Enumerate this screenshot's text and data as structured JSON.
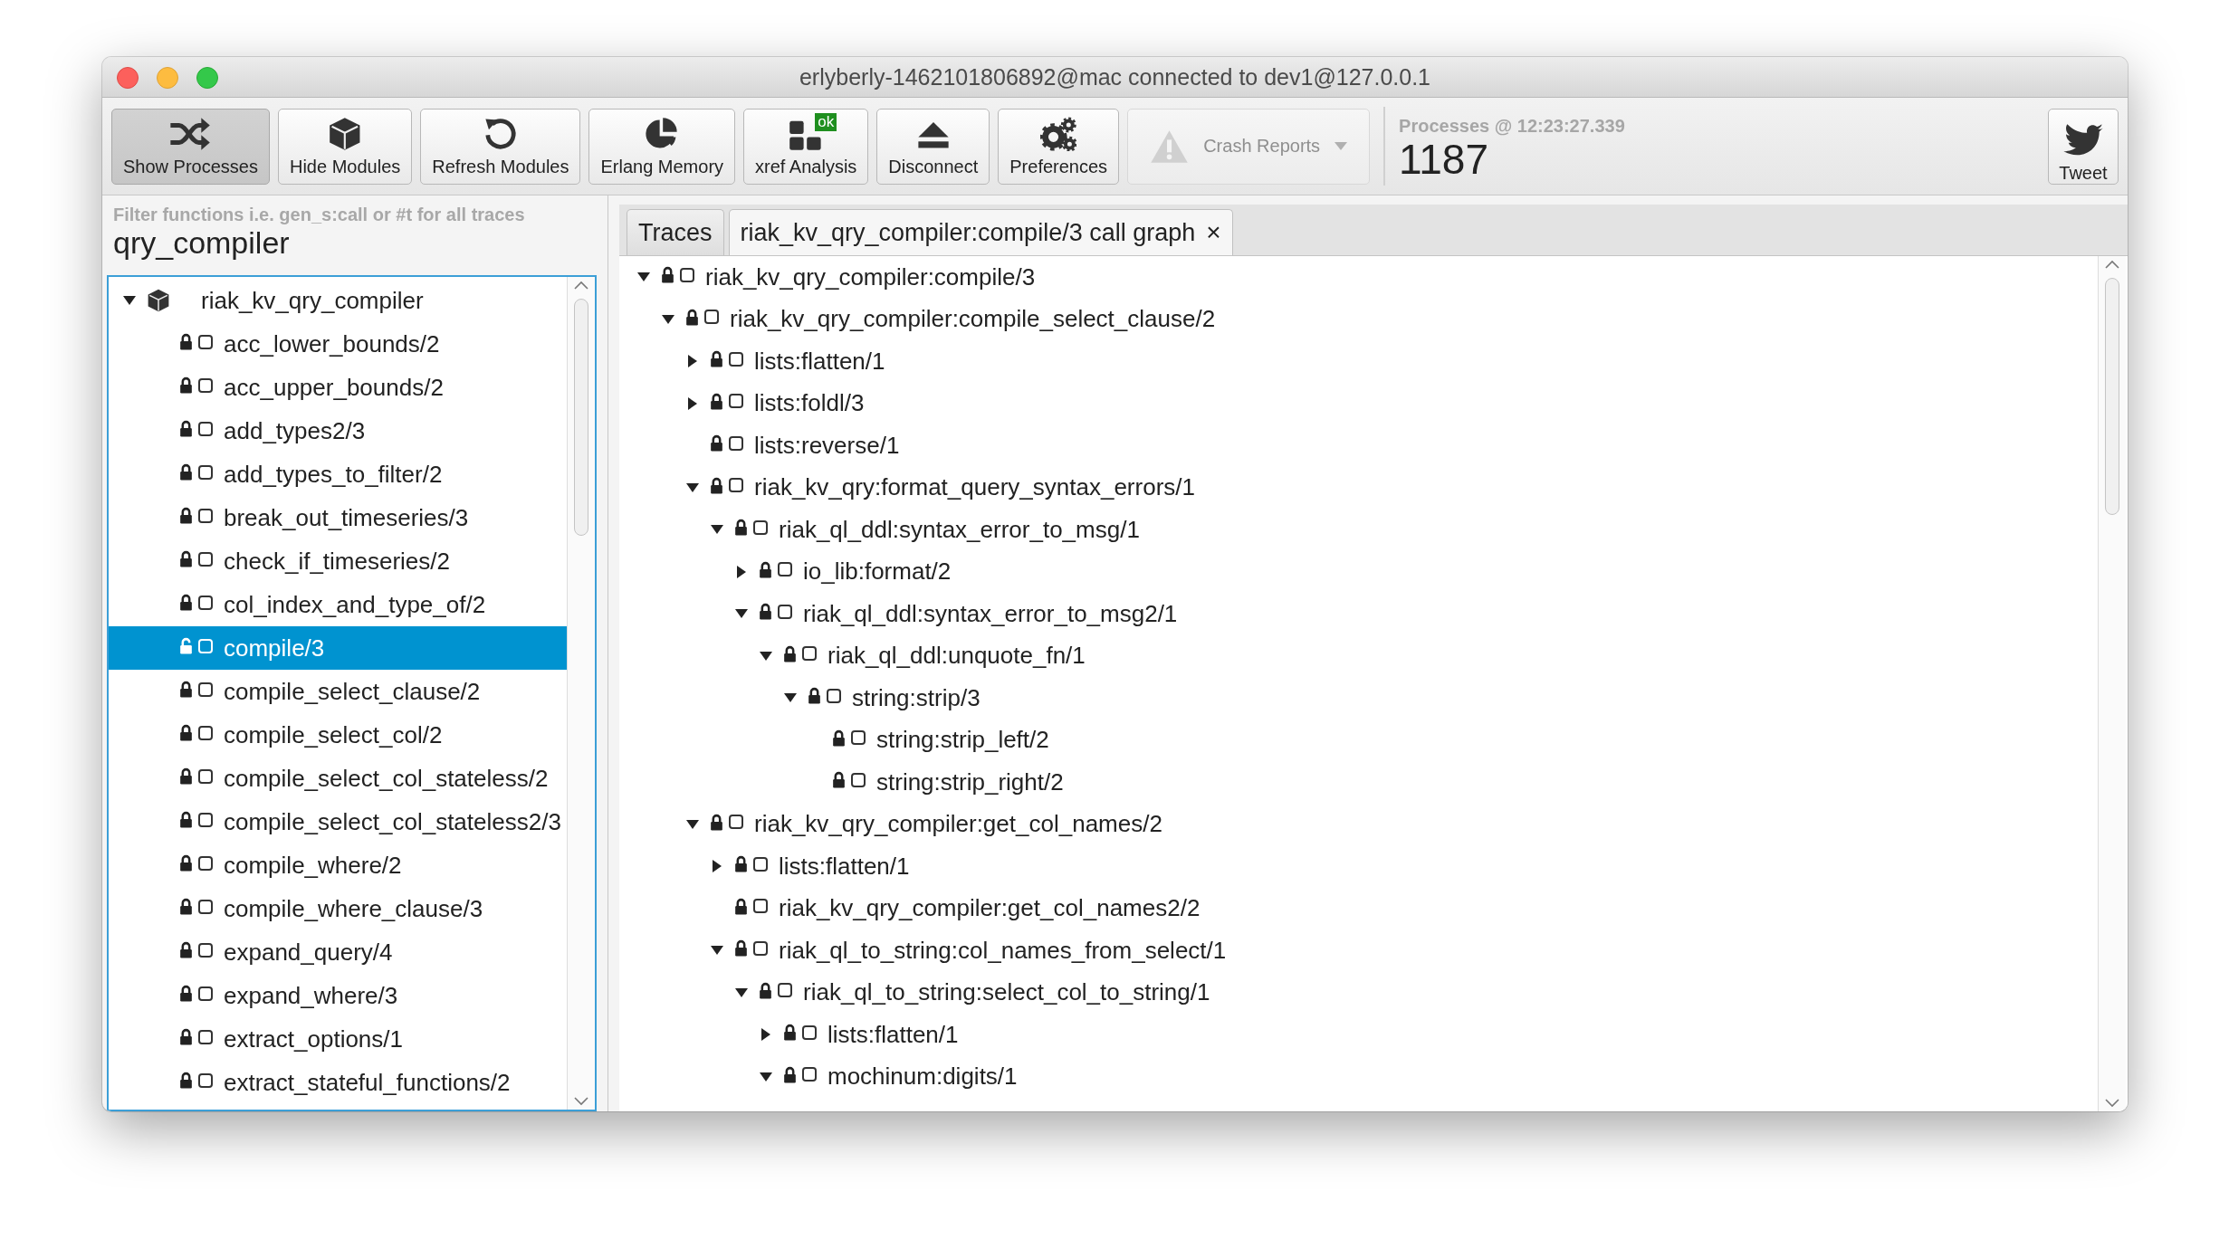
{
  "window": {
    "title": "erlyberly-1462101806892@mac connected to dev1@127.0.0.1"
  },
  "toolbar": {
    "buttons": [
      {
        "label": "Show Processes",
        "selected": true,
        "disabled": false
      },
      {
        "label": "Hide Modules",
        "selected": false,
        "disabled": false
      },
      {
        "label": "Refresh Modules",
        "selected": false,
        "disabled": false
      },
      {
        "label": "Erlang Memory",
        "selected": false,
        "disabled": false
      },
      {
        "label": "xref Analysis",
        "badge": "ok",
        "selected": false,
        "disabled": false
      },
      {
        "label": "Disconnect",
        "selected": false,
        "disabled": false
      },
      {
        "label": "Preferences",
        "selected": false,
        "disabled": false
      },
      {
        "label": "Crash Reports",
        "selected": false,
        "disabled": true,
        "dropdown": true
      }
    ],
    "processes": {
      "label": "Processes @ 12:23:27.339",
      "count": "1187"
    },
    "tweet": {
      "label": "Tweet"
    }
  },
  "filter": {
    "label": "Filter functions i.e. gen_s:call or #t for all traces",
    "value": "qry_compiler"
  },
  "modules": [
    {
      "name": "riak_kv_qry_compiler",
      "expanded": true,
      "functions": [
        {
          "name": "acc_lower_bounds/2",
          "locked": true,
          "checked": false,
          "selected": false
        },
        {
          "name": "acc_upper_bounds/2",
          "locked": true,
          "checked": false,
          "selected": false
        },
        {
          "name": "add_types2/3",
          "locked": true,
          "checked": false,
          "selected": false
        },
        {
          "name": "add_types_to_filter/2",
          "locked": true,
          "checked": false,
          "selected": false
        },
        {
          "name": "break_out_timeseries/3",
          "locked": true,
          "checked": false,
          "selected": false
        },
        {
          "name": "check_if_timeseries/2",
          "locked": true,
          "checked": false,
          "selected": false
        },
        {
          "name": "col_index_and_type_of/2",
          "locked": true,
          "checked": false,
          "selected": false
        },
        {
          "name": "compile/3",
          "locked": false,
          "checked": false,
          "selected": true
        },
        {
          "name": "compile_select_clause/2",
          "locked": true,
          "checked": false,
          "selected": false
        },
        {
          "name": "compile_select_col/2",
          "locked": true,
          "checked": false,
          "selected": false
        },
        {
          "name": "compile_select_col_stateless/2",
          "locked": true,
          "checked": false,
          "selected": false
        },
        {
          "name": "compile_select_col_stateless2/3",
          "locked": true,
          "checked": false,
          "selected": false
        },
        {
          "name": "compile_where/2",
          "locked": true,
          "checked": false,
          "selected": false
        },
        {
          "name": "compile_where_clause/3",
          "locked": true,
          "checked": false,
          "selected": false
        },
        {
          "name": "expand_query/4",
          "locked": true,
          "checked": false,
          "selected": false
        },
        {
          "name": "expand_where/3",
          "locked": true,
          "checked": false,
          "selected": false
        },
        {
          "name": "extract_options/1",
          "locked": true,
          "checked": false,
          "selected": false
        },
        {
          "name": "extract_stateful_functions/2",
          "locked": true,
          "checked": false,
          "selected": false
        }
      ]
    }
  ],
  "tabs": [
    {
      "label": "Traces",
      "selected": false
    },
    {
      "label": "riak_kv_qry_compiler:compile/3 call graph",
      "selected": true,
      "close": "×"
    }
  ],
  "call_graph": [
    {
      "name": "riak_kv_qry_compiler:compile/3",
      "locked": true,
      "checked": false,
      "expanded": true,
      "children": [
        {
          "name": "riak_kv_qry_compiler:compile_select_clause/2",
          "locked": true,
          "checked": false,
          "expanded": true,
          "children": [
            {
              "name": "lists:flatten/1",
              "locked": true,
              "checked": false,
              "expanded": false
            },
            {
              "name": "lists:foldl/3",
              "locked": true,
              "checked": false,
              "expanded": false
            },
            {
              "name": "lists:reverse/1",
              "locked": true,
              "checked": false
            },
            {
              "name": "riak_kv_qry:format_query_syntax_errors/1",
              "locked": true,
              "checked": false,
              "expanded": true,
              "children": [
                {
                  "name": "riak_ql_ddl:syntax_error_to_msg/1",
                  "locked": true,
                  "checked": false,
                  "expanded": true,
                  "children": [
                    {
                      "name": "io_lib:format/2",
                      "locked": true,
                      "checked": false,
                      "expanded": false
                    },
                    {
                      "name": "riak_ql_ddl:syntax_error_to_msg2/1",
                      "locked": true,
                      "checked": false,
                      "expanded": true,
                      "children": [
                        {
                          "name": "riak_ql_ddl:unquote_fn/1",
                          "locked": true,
                          "checked": false,
                          "expanded": true,
                          "children": [
                            {
                              "name": "string:strip/3",
                              "locked": true,
                              "checked": false,
                              "expanded": true,
                              "children": [
                                {
                                  "name": "string:strip_left/2",
                                  "locked": true,
                                  "checked": false
                                },
                                {
                                  "name": "string:strip_right/2",
                                  "locked": true,
                                  "checked": false
                                }
                              ]
                            }
                          ]
                        }
                      ]
                    }
                  ]
                }
              ]
            },
            {
              "name": "riak_kv_qry_compiler:get_col_names/2",
              "locked": true,
              "checked": false,
              "expanded": true,
              "children": [
                {
                  "name": "lists:flatten/1",
                  "locked": true,
                  "checked": false,
                  "expanded": false
                },
                {
                  "name": "riak_kv_qry_compiler:get_col_names2/2",
                  "locked": true,
                  "checked": false
                },
                {
                  "name": "riak_ql_to_string:col_names_from_select/1",
                  "locked": true,
                  "checked": false,
                  "expanded": true,
                  "children": [
                    {
                      "name": "riak_ql_to_string:select_col_to_string/1",
                      "locked": true,
                      "checked": false,
                      "expanded": true,
                      "children": [
                        {
                          "name": "lists:flatten/1",
                          "locked": true,
                          "checked": false,
                          "expanded": false
                        },
                        {
                          "name": "mochinum:digits/1",
                          "locked": true,
                          "checked": false,
                          "expanded": true
                        }
                      ]
                    }
                  ]
                }
              ]
            }
          ]
        }
      ]
    }
  ]
}
